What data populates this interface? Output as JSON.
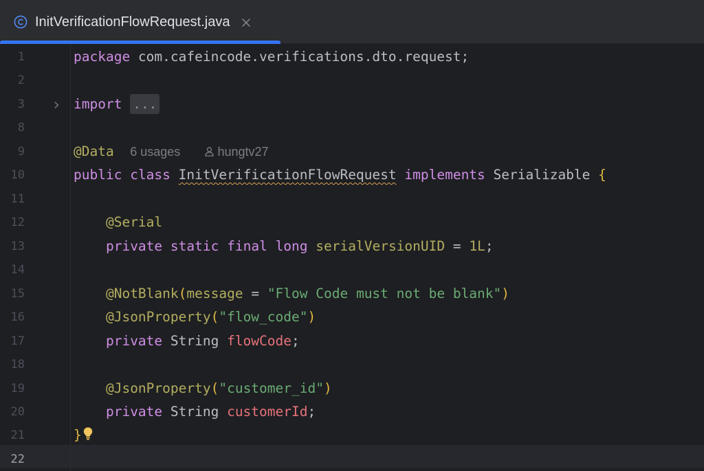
{
  "tab": {
    "title": "InitVerificationFlowRequest.java",
    "icon": "java-class-icon",
    "close_icon": "close-icon",
    "accent": "#3574f0"
  },
  "editor": {
    "current_line": "22",
    "lines": [
      {
        "num": "1"
      },
      {
        "num": "2"
      },
      {
        "num": "3"
      },
      {
        "num": "8"
      },
      {
        "num": "9"
      },
      {
        "num": "10"
      },
      {
        "num": "11"
      },
      {
        "num": "12"
      },
      {
        "num": "13"
      },
      {
        "num": "14"
      },
      {
        "num": "15"
      },
      {
        "num": "16"
      },
      {
        "num": "17"
      },
      {
        "num": "18"
      },
      {
        "num": "19"
      },
      {
        "num": "20"
      },
      {
        "num": "21"
      },
      {
        "num": "22"
      }
    ],
    "code": {
      "l1_package": "package",
      "l1_name": " com.cafeincode.verifications.dto.request;",
      "l3_import": "import",
      "l3_folded": "...",
      "l9_ann": "@Data",
      "l9_usages": "6 usages",
      "l9_author": "hungtv27",
      "l10_public": "public",
      "l10_class": "class",
      "l10_name": "InitVerificationFlowRequest",
      "l10_implements": "implements",
      "l10_iface": " Serializable ",
      "l10_brace": "{",
      "l12_ann": "@Serial",
      "l13_private": "private",
      "l13_static": "static",
      "l13_final": "final",
      "l13_long": "long",
      "l13_field": "serialVersionUID",
      "l13_eq": " = ",
      "l13_num": "1L",
      "l13_semi": ";",
      "l15_ann": "@NotBlank",
      "l15_open": "(",
      "l15_param": "message",
      "l15_eq": " = ",
      "l15_str": "\"Flow Code must not be blank\"",
      "l15_close": ")",
      "l16_ann": "@JsonProperty",
      "l16_open": "(",
      "l16_str": "\"flow_code\"",
      "l16_close": ")",
      "l17_private": "private",
      "l17_type": " String ",
      "l17_field": "flowCode",
      "l17_semi": ";",
      "l19_ann": "@JsonProperty",
      "l19_open": "(",
      "l19_str": "\"customer_id\"",
      "l19_close": ")",
      "l20_private": "private",
      "l20_type": " String ",
      "l20_field": "customerId",
      "l20_semi": ";",
      "l21_brace": "}"
    }
  }
}
